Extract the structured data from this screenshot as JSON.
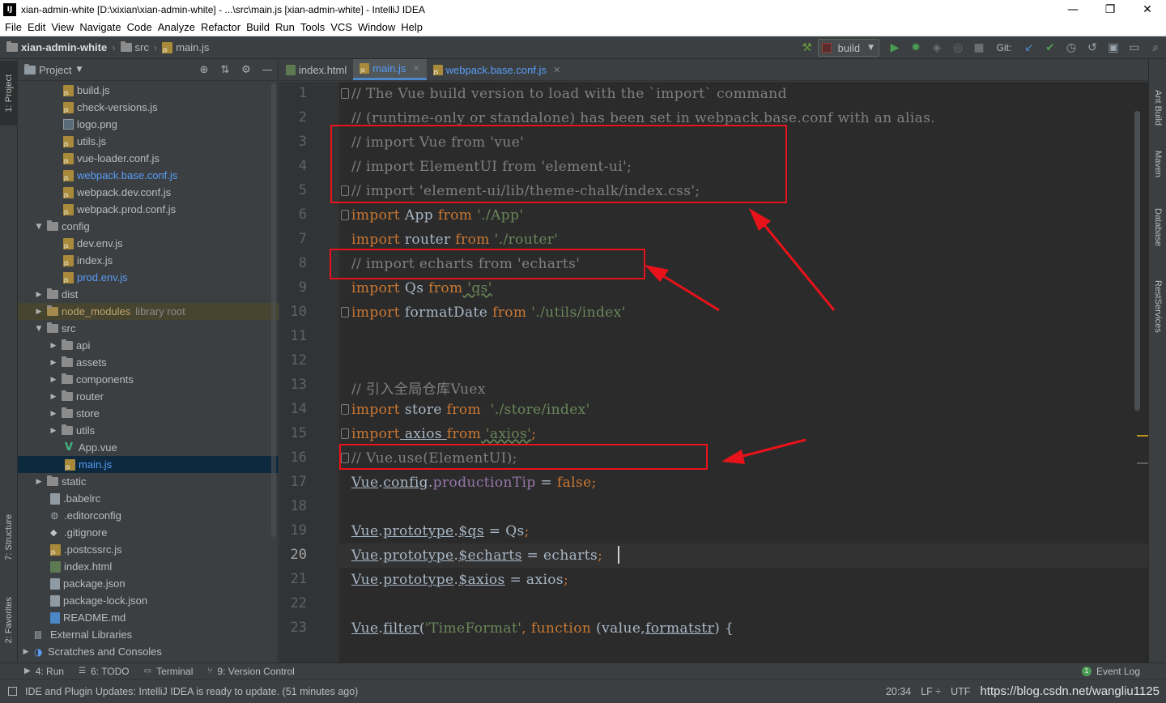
{
  "window": {
    "title": "xian-admin-white [D:\\xixian\\xian-admin-white] - ...\\src\\main.js [xian-admin-white] - IntelliJ IDEA",
    "app_icon": "IJ",
    "minimize": "—",
    "maximize": "❐",
    "close": "✕"
  },
  "menu": [
    "File",
    "Edit",
    "View",
    "Navigate",
    "Code",
    "Analyze",
    "Refactor",
    "Build",
    "Run",
    "Tools",
    "VCS",
    "Window",
    "Help"
  ],
  "breadcrumb": {
    "project": "xian-admin-white",
    "folder": "src",
    "file": "main.js"
  },
  "toolbar": {
    "run_config": "build",
    "git_label": "Git:"
  },
  "left_tabs": {
    "project": "1: Project",
    "structure": "7: Structure",
    "favorites": "2: Favorites"
  },
  "right_tabs": {
    "ant": "Ant Build",
    "maven": "Maven",
    "database": "Database",
    "rest": "RestServices"
  },
  "project_panel": {
    "title": "Project",
    "items": [
      {
        "label": "build.js",
        "type": "js"
      },
      {
        "label": "check-versions.js",
        "type": "js"
      },
      {
        "label": "logo.png",
        "type": "img"
      },
      {
        "label": "utils.js",
        "type": "js"
      },
      {
        "label": "vue-loader.conf.js",
        "type": "js"
      },
      {
        "label": "webpack.base.conf.js",
        "type": "js"
      },
      {
        "label": "webpack.dev.conf.js",
        "type": "js"
      },
      {
        "label": "webpack.prod.conf.js",
        "type": "js"
      },
      {
        "label": "config",
        "type": "folder"
      },
      {
        "label": "dev.env.js",
        "type": "js"
      },
      {
        "label": "index.js",
        "type": "js"
      },
      {
        "label": "prod.env.js",
        "type": "js"
      },
      {
        "label": "dist",
        "type": "folder"
      },
      {
        "label": "node_modules",
        "suffix": "library root",
        "type": "folder"
      },
      {
        "label": "src",
        "type": "folder"
      },
      {
        "label": "api",
        "type": "folder"
      },
      {
        "label": "assets",
        "type": "folder"
      },
      {
        "label": "components",
        "type": "folder"
      },
      {
        "label": "router",
        "type": "folder"
      },
      {
        "label": "store",
        "type": "folder"
      },
      {
        "label": "utils",
        "type": "folder"
      },
      {
        "label": "App.vue",
        "type": "vue"
      },
      {
        "label": "main.js",
        "type": "js"
      },
      {
        "label": "static",
        "type": "folder"
      },
      {
        "label": ".babelrc",
        "type": "file"
      },
      {
        "label": ".editorconfig",
        "type": "gear"
      },
      {
        "label": ".gitignore",
        "type": "git"
      },
      {
        "label": ".postcssrc.js",
        "type": "js"
      },
      {
        "label": "index.html",
        "type": "html"
      },
      {
        "label": "package.json",
        "type": "file"
      },
      {
        "label": "package-lock.json",
        "type": "file"
      },
      {
        "label": "README.md",
        "type": "md"
      },
      {
        "label": "External Libraries",
        "type": "lib"
      },
      {
        "label": "Scratches and Consoles",
        "type": "scratch"
      }
    ]
  },
  "editor_tabs": [
    {
      "label": "index.html",
      "active": false
    },
    {
      "label": "main.js",
      "active": true
    },
    {
      "label": "webpack.base.conf.js",
      "active": false
    }
  ],
  "code_lines": [
    "1",
    "2",
    "3",
    "4",
    "5",
    "6",
    "7",
    "8",
    "9",
    "10",
    "11",
    "12",
    "13",
    "14",
    "15",
    "16",
    "17",
    "18",
    "19",
    "20",
    "21",
    "22",
    "23"
  ],
  "code": {
    "l1": "// The Vue build version to load with the `import` command",
    "l2": "// (runtime-only or standalone) has been set in webpack.base.conf with an alias.",
    "l3": "// import Vue from 'vue'",
    "l4": "// import ElementUI from 'element-ui';",
    "l5": "// import 'element-ui/lib/theme-chalk/index.css';",
    "l6_kw1": "import",
    "l6_id": " App ",
    "l6_kw2": "from",
    "l6_str": " './App'",
    "l7_kw1": "import",
    "l7_id": " router ",
    "l7_kw2": "from",
    "l7_str": " './router'",
    "l8": "// import echarts from 'echarts'",
    "l9_kw1": "import",
    "l9_id": " Qs ",
    "l9_kw2": "from",
    "l9_str": " 'qs'",
    "l10_kw1": "import",
    "l10_id": " formatDate ",
    "l10_kw2": "from",
    "l10_str": " './utils/index'",
    "l13": "// 引入全局仓库Vuex",
    "l14_kw1": "import",
    "l14_id": " store ",
    "l14_kw2": "from",
    "l14_str": "  './store/index'",
    "l15_kw1": "import",
    "l15_id": " axios ",
    "l15_kw2": "from",
    "l15_str": " 'axios'",
    "l15_end": ";",
    "l16": "// Vue.use(ElementUI);",
    "l17_a": "Vue",
    "l17_b": ".",
    "l17_c": "config",
    "l17_d": ".",
    "l17_e": "productionTip",
    "l17_f": " = ",
    "l17_g": "false",
    "l17_h": ";",
    "l19_a": "Vue",
    "l19_b": ".",
    "l19_c": "prototype",
    "l19_d": ".",
    "l19_e": "$qs",
    "l19_f": " = Qs",
    "l19_g": ";",
    "l20_a": "Vue",
    "l20_b": ".",
    "l20_c": "prototype",
    "l20_d": ".",
    "l20_e": "$echarts",
    "l20_f": " = echarts",
    "l20_g": ";",
    "l21_a": "Vue",
    "l21_b": ".",
    "l21_c": "prototype",
    "l21_d": ".",
    "l21_e": "$axios",
    "l21_f": " = axios",
    "l21_g": ";",
    "l23_a": "Vue",
    "l23_b": ".",
    "l23_c": "filter",
    "l23_d": "(",
    "l23_e": "'TimeFormat'",
    "l23_f": ", ",
    "l23_g": "function",
    "l23_h": " (value,",
    "l23_i": "formatstr",
    "l23_j": ") {"
  },
  "bottom_tabs": [
    {
      "label": "4: Run",
      "icon": "run-icon"
    },
    {
      "label": "6: TODO",
      "icon": "todo-icon"
    },
    {
      "label": "Terminal",
      "icon": "terminal-icon"
    },
    {
      "label": "9: Version Control",
      "icon": "vcs-icon"
    }
  ],
  "event_log": "Event Log",
  "event_count": "1",
  "status": {
    "message": "IDE and Plugin Updates: IntelliJ IDEA is ready to update. (51 minutes ago)",
    "position": "20:34",
    "line_sep": "LF ÷",
    "encoding": "UTF",
    "watermark": "https://blog.csdn.net/wangliu1125"
  },
  "colors": {
    "annotation_red": "#e8131a",
    "keyword": "#cc7832",
    "string": "#6a8759",
    "comment": "#808080"
  }
}
